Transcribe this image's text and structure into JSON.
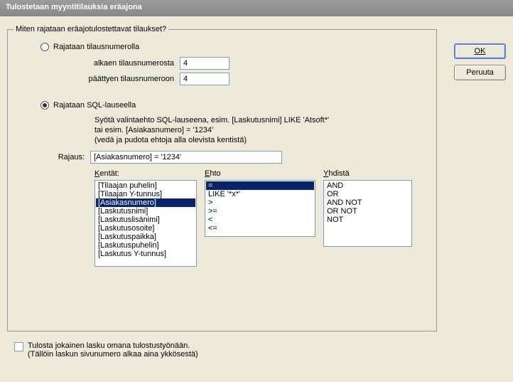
{
  "title": "Tulostetaan myyntitilauksia eräajona",
  "buttons": {
    "ok": "OK",
    "cancel": "Peruuta"
  },
  "fieldset_legend": "Miten rajataan eräajotulostettavat tilaukset?",
  "radio1": {
    "label": "Rajataan tilausnumerolla",
    "checked": false
  },
  "from_label": "alkaen tilausnumerosta",
  "from_value": "4",
  "to_label": "päättyen tilausnumeroon",
  "to_value": "4",
  "radio2": {
    "label": "Rajataan SQL-lauseella",
    "checked": true
  },
  "hint_line1": "Syötä valintaehto SQL-lauseena, esim. [Laskutusnimi] LIKE 'Atsoft*'",
  "hint_line2": "tai esim. [Asiakasnumero] = '1234'",
  "hint_line3": "(vedä ja pudota ehtoja alla olevista kentistä)",
  "rajaus_label": "Rajaus:",
  "rajaus_value": "[Asiakasnumero] = '1234'",
  "col_kentta": "entät:",
  "col_ehto": "hto",
  "col_yhdista": "hdistä",
  "kentta_items": [
    {
      "t": "[Tilaajan puhelin]",
      "sel": false
    },
    {
      "t": "[Tilaajan Y-tunnus]",
      "sel": false
    },
    {
      "t": "[Asiakasnumero]",
      "sel": true
    },
    {
      "t": "[Laskutusnimi]",
      "sel": false
    },
    {
      "t": "[Laskutuslisänimi]",
      "sel": false
    },
    {
      "t": "[Laskutusosoite]",
      "sel": false
    },
    {
      "t": "[Laskutuspaikka]",
      "sel": false
    },
    {
      "t": "[Laskutuspuhelin]",
      "sel": false
    },
    {
      "t": "[Laskutus Y-tunnus]",
      "sel": false
    }
  ],
  "ehto_items": [
    {
      "t": "=",
      "sel": true
    },
    {
      "t": "LIKE '*x*'",
      "sel": false
    },
    {
      "t": ">",
      "sel": false
    },
    {
      "t": ">=",
      "sel": false
    },
    {
      "t": "<",
      "sel": false
    },
    {
      "t": "<=",
      "sel": false
    }
  ],
  "yhdista_items": [
    {
      "t": "AND",
      "sel": false
    },
    {
      "t": "OR",
      "sel": false
    },
    {
      "t": "AND NOT",
      "sel": false
    },
    {
      "t": "OR NOT",
      "sel": false
    },
    {
      "t": "NOT",
      "sel": false
    }
  ],
  "checkbox_line1": "Tulosta jokainen lasku omana tulostustyönään.",
  "checkbox_line2": "(Tällöin laskun sivunumero alkaa aina ykkösestä)"
}
